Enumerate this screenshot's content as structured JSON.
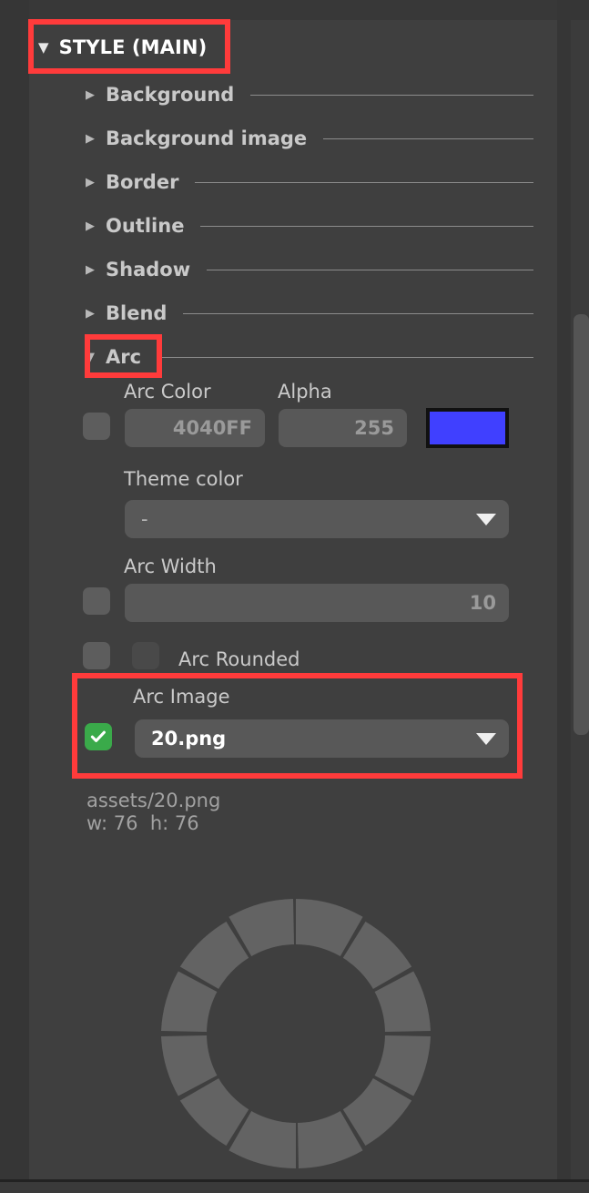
{
  "panel": {
    "header": {
      "caret": "▼",
      "title": "STYLE (MAIN)"
    },
    "sections": [
      {
        "caret": "▶",
        "label": "Background"
      },
      {
        "caret": "▶",
        "label": "Background image"
      },
      {
        "caret": "▶",
        "label": "Border"
      },
      {
        "caret": "▶",
        "label": "Outline"
      },
      {
        "caret": "▶",
        "label": "Shadow"
      },
      {
        "caret": "▶",
        "label": "Blend"
      },
      {
        "caret": "▼",
        "label": "Arc"
      }
    ],
    "arc": {
      "color_label": "Arc Color",
      "color_value": "4040FF",
      "alpha_label": "Alpha",
      "alpha_value": "255",
      "swatch_color": "#4040FF",
      "theme_color_label": "Theme color",
      "theme_color_value": "-",
      "width_label": "Arc Width",
      "width_value": "10",
      "rounded_label": "Arc Rounded",
      "image_label": "Arc Image",
      "image_value": "20.png",
      "asset_path": "assets/20.png",
      "asset_dims": "w: 76  h: 76"
    }
  },
  "highlights": {
    "style_main": "annotation-style-main",
    "arc_section": "annotation-arc-section",
    "arc_image": "annotation-arc-image"
  },
  "colors": {
    "accent_red": "#FF3B3B",
    "checkbox_green": "#3AAA4A",
    "panel_bg": "#3F3F3F",
    "input_bg": "#585858"
  },
  "preview": {
    "segments": 12,
    "segment_color": "#636363"
  }
}
